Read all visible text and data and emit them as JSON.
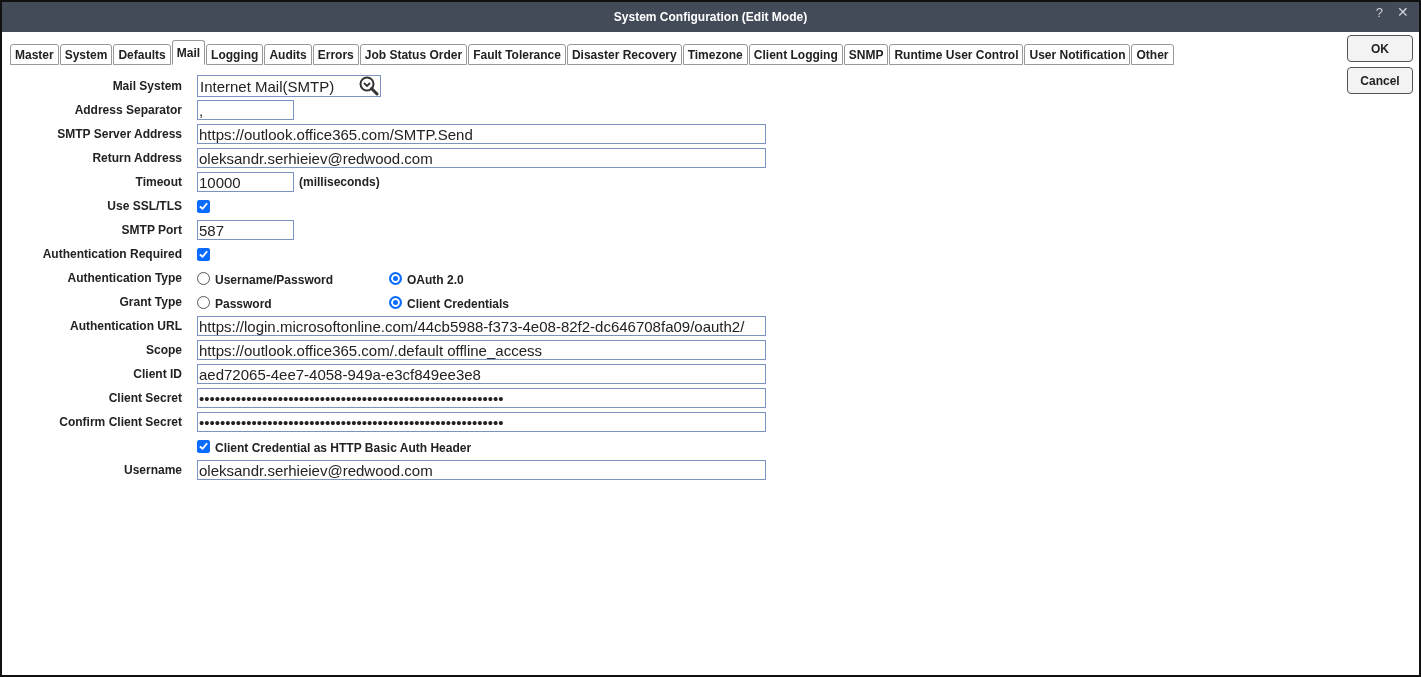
{
  "window": {
    "title": "System Configuration (Edit Mode)",
    "help": "?",
    "close": "✕"
  },
  "tabs": [
    {
      "label": "Master",
      "selected": false
    },
    {
      "label": "System",
      "selected": false
    },
    {
      "label": "Defaults",
      "selected": false
    },
    {
      "label": "Mail",
      "selected": true
    },
    {
      "label": "Logging",
      "selected": false
    },
    {
      "label": "Audits",
      "selected": false
    },
    {
      "label": "Errors",
      "selected": false
    },
    {
      "label": "Job Status Order",
      "selected": false
    },
    {
      "label": "Fault Tolerance",
      "selected": false
    },
    {
      "label": "Disaster Recovery",
      "selected": false
    },
    {
      "label": "Timezone",
      "selected": false
    },
    {
      "label": "Client Logging",
      "selected": false
    },
    {
      "label": "SNMP",
      "selected": false
    },
    {
      "label": "Runtime User Control",
      "selected": false
    },
    {
      "label": "User Notification",
      "selected": false
    },
    {
      "label": "Other",
      "selected": false
    }
  ],
  "buttons": [
    "OK",
    "Cancel"
  ],
  "fields": [
    {
      "kind": "lookup",
      "label": "Mail System",
      "value": "Internet Mail(SMTP)"
    },
    {
      "kind": "short",
      "label": "Address Separator",
      "value": ","
    },
    {
      "kind": "long",
      "label": "SMTP Server Address",
      "value": "https://outlook.office365.com/SMTP.Send"
    },
    {
      "kind": "long",
      "label": "Return Address",
      "value": "oleksandr.serhieiev@redwood.com"
    },
    {
      "kind": "short",
      "label": "Timeout",
      "value": "10000",
      "unit": "(milliseconds)"
    },
    {
      "kind": "checkbox",
      "label": "Use SSL/TLS",
      "checked": true
    },
    {
      "kind": "short",
      "label": "SMTP Port",
      "value": "587"
    },
    {
      "kind": "checkbox",
      "label": "Authentication Required",
      "checked": true
    },
    {
      "kind": "radio",
      "label": "Authentication Type",
      "options": [
        {
          "label": "Username/Password",
          "selected": false
        },
        {
          "label": "OAuth 2.0",
          "selected": true
        }
      ]
    },
    {
      "kind": "radio",
      "label": "Grant Type",
      "options": [
        {
          "label": "Password",
          "selected": false
        },
        {
          "label": "Client Credentials",
          "selected": true
        }
      ]
    },
    {
      "kind": "long",
      "label": "Authentication URL",
      "value": "https://login.microsoftonline.com/44cb5988-f373-4e08-82f2-dc646708fa09/oauth2/"
    },
    {
      "kind": "long",
      "label": "Scope",
      "value": "https://outlook.office365.com/.default offline_access"
    },
    {
      "kind": "long",
      "label": "Client ID",
      "value": "aed72065-4ee7-4058-949a-e3cf849ee3e8"
    },
    {
      "kind": "long",
      "label": "Client Secret",
      "value": "••••••••••••••••••••••••••••••••••••••••••••••••••••••••••"
    },
    {
      "kind": "long",
      "label": "Confirm Client Secret",
      "value": "••••••••••••••••••••••••••••••••••••••••••••••••••••••••••"
    },
    {
      "kind": "option",
      "option": "Client Credential as HTTP Basic Auth Header",
      "checked": true
    },
    {
      "kind": "long",
      "label": "Username",
      "value": "oleksandr.serhieiev@redwood.com"
    }
  ]
}
